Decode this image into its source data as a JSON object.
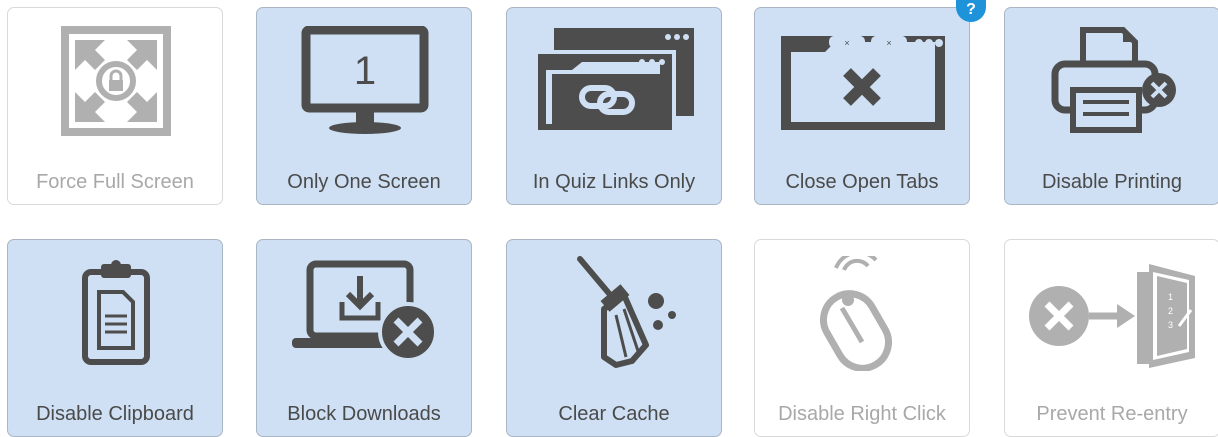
{
  "help_badge": "?",
  "colors": {
    "enabled_bg": "#cfe0f4",
    "disabled_bg": "#ffffff",
    "icon_dark": "#4d4d4d",
    "icon_light": "#b0b0b0",
    "badge": "#1e93d9"
  },
  "tiles": [
    {
      "label": "Force Full Screen",
      "enabled": false,
      "icon": "fullscreen-lock-icon"
    },
    {
      "label": "Only One Screen",
      "enabled": true,
      "icon": "monitor-one-icon",
      "monitor_number": "1"
    },
    {
      "label": "In Quiz Links Only",
      "enabled": true,
      "icon": "browser-link-icon"
    },
    {
      "label": "Close Open Tabs",
      "enabled": true,
      "icon": "close-tabs-icon"
    },
    {
      "label": "Disable Printing",
      "enabled": true,
      "icon": "printer-disabled-icon"
    },
    {
      "label": "Disable Clipboard",
      "enabled": true,
      "icon": "clipboard-icon"
    },
    {
      "label": "Block Downloads",
      "enabled": true,
      "icon": "laptop-download-blocked-icon"
    },
    {
      "label": "Clear Cache",
      "enabled": true,
      "icon": "broom-icon"
    },
    {
      "label": "Disable Right Click",
      "enabled": false,
      "icon": "mouse-click-icon"
    },
    {
      "label": "Prevent Re-entry",
      "enabled": false,
      "icon": "exit-door-icon",
      "door_numbers": [
        "1",
        "2",
        "3"
      ]
    }
  ]
}
